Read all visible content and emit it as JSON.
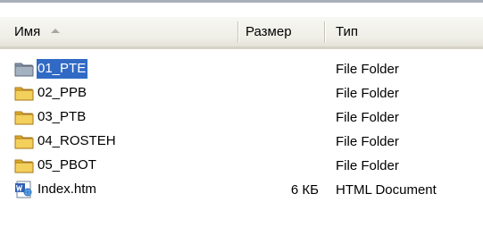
{
  "columns": {
    "name": "Имя",
    "size": "Размер",
    "type": "Тип"
  },
  "sort_icon": "sort-ascending-icon",
  "colors": {
    "selection": "#316ac5",
    "folder": "#f1c94d",
    "header_bg": "#efeee7"
  },
  "files": [
    {
      "name": "01_PTE",
      "size": "",
      "type": "File Folder",
      "icon": "folder-icon",
      "selected": true
    },
    {
      "name": "02_PPB",
      "size": "",
      "type": "File Folder",
      "icon": "folder-icon",
      "selected": false
    },
    {
      "name": "03_PTB",
      "size": "",
      "type": "File Folder",
      "icon": "folder-icon",
      "selected": false
    },
    {
      "name": "04_ROSTEH",
      "size": "",
      "type": "File Folder",
      "icon": "folder-icon",
      "selected": false
    },
    {
      "name": "05_PBOT",
      "size": "",
      "type": "File Folder",
      "icon": "folder-icon",
      "selected": false
    },
    {
      "name": "Index.htm",
      "size": "6 КБ",
      "type": "HTML Document",
      "icon": "word-html-document-icon",
      "selected": false
    }
  ]
}
